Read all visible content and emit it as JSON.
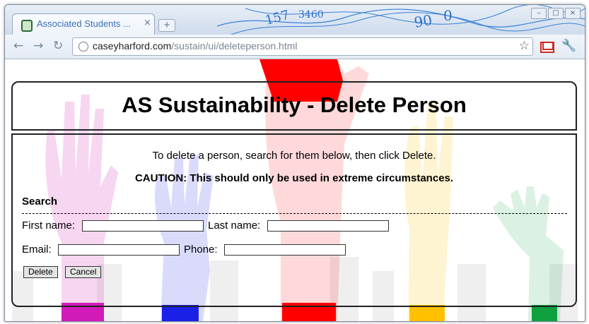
{
  "browser": {
    "tab_title": "Associated Students ...",
    "url_domain": "caseyharford.com",
    "url_path": "/sustain/ui/deleteperson.html",
    "tab_close_glyph": "×",
    "newtab_glyph": "+",
    "back_glyph": "←",
    "forward_glyph": "→",
    "reload_glyph": "↻",
    "star_glyph": "☆",
    "wrench_glyph": "🔧"
  },
  "page": {
    "title": "AS Sustainability - Delete Person",
    "intro": "To delete a person, search for them below, then click Delete.",
    "caution": "CAUTION: This should only be used in extreme circumstances.",
    "search_heading": "Search",
    "first_name_label": "First name:",
    "last_name_label": "Last name:",
    "email_label": "Email:",
    "phone_label": "Phone:",
    "first_name_value": "",
    "last_name_value": "",
    "email_value": "",
    "phone_value": "",
    "delete_button": "Delete",
    "cancel_button": "Cancel"
  },
  "colors": {
    "hand_magenta": "#d21ab8",
    "hand_blue": "#1a20e8",
    "hand_red": "#ff0000",
    "hand_yellow": "#ffc000",
    "hand_green": "#10a040"
  }
}
